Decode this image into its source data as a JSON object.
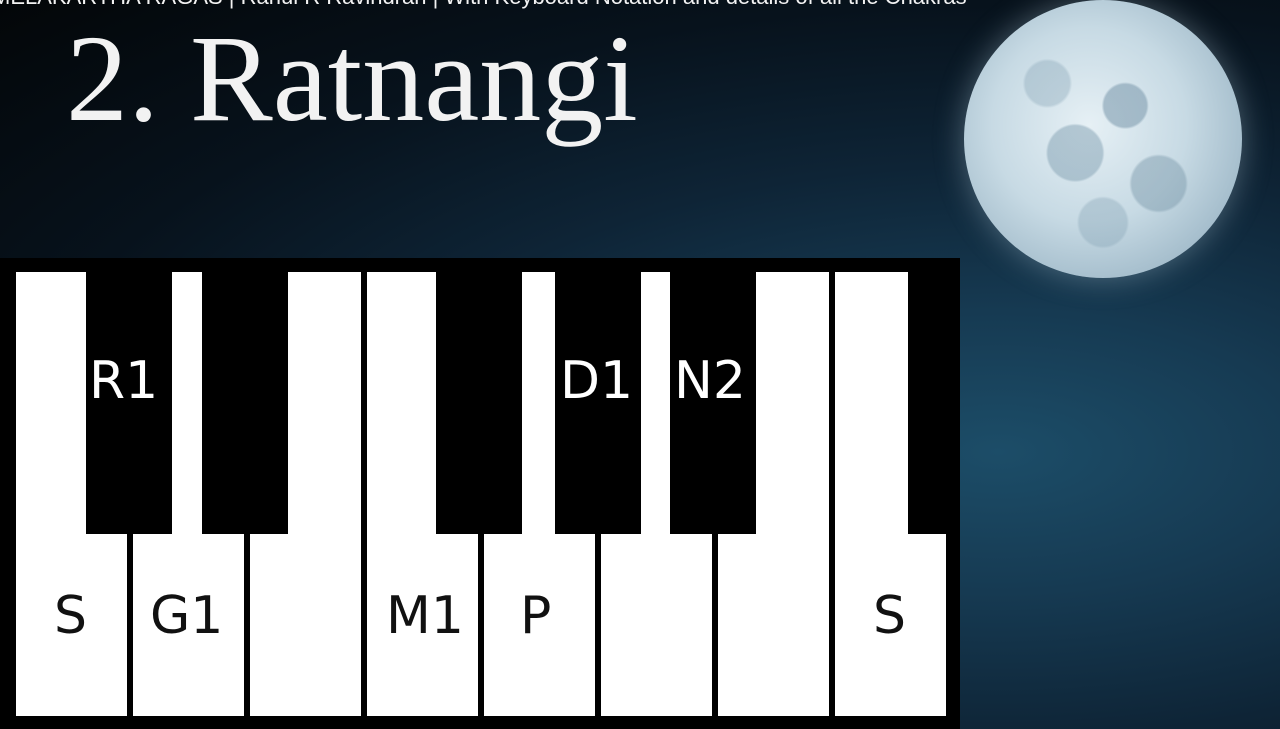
{
  "video_title": "MELAKARTHA RAGAS | Rahul R Ravindran | With Keyboard Notation and details of all the Chakras",
  "raga_title": "2. Ratnangi",
  "keyboard": {
    "white_key_labels": [
      "S",
      "G1",
      "M1",
      "P",
      "S"
    ],
    "black_key_labels": [
      "R1",
      "D1",
      "N2"
    ]
  },
  "colors": {
    "white_key": "#ffffff",
    "black_key": "#000000",
    "sky": "#163a52"
  }
}
